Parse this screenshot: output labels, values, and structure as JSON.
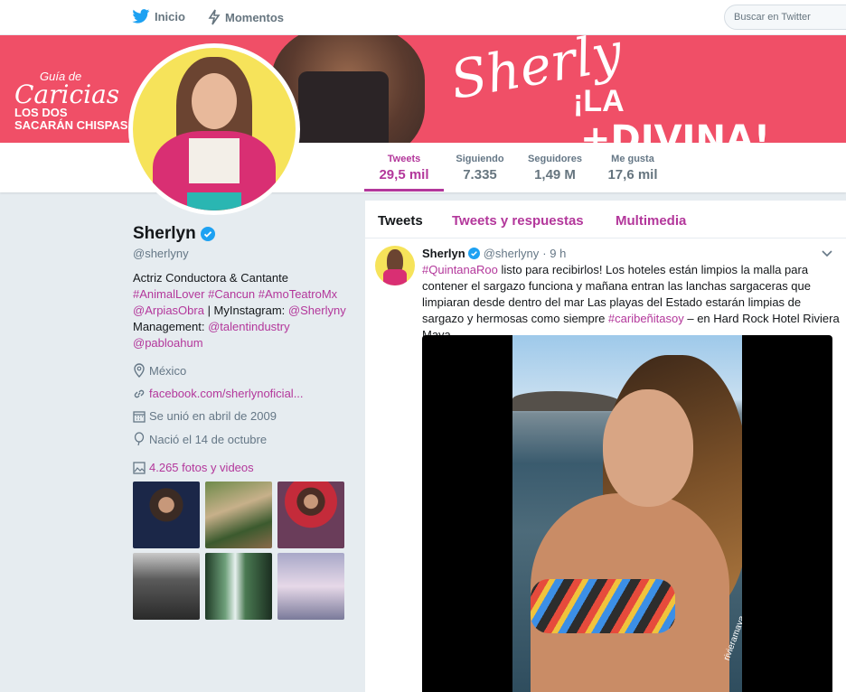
{
  "nav": {
    "home_label": "Inicio",
    "moments_label": "Momentos",
    "search_placeholder": "Buscar en Twitter"
  },
  "banner": {
    "guia_small": "Guía de",
    "guia_big": "Caricias",
    "guia_line1": "LOS DOS",
    "guia_line2": "SACARÁN CHISPAS",
    "script": "Sherly",
    "la": "¡LA",
    "divina": "+DIVINA!"
  },
  "stats": [
    {
      "label": "Tweets",
      "value": "29,5 mil"
    },
    {
      "label": "Siguiendo",
      "value": "7.335"
    },
    {
      "label": "Seguidores",
      "value": "1,49 M"
    },
    {
      "label": "Me gusta",
      "value": "17,6 mil"
    }
  ],
  "profile": {
    "name": "Sherlyn",
    "handle": "@sherlyny",
    "bio_line1": "Actriz Conductora & Cantante",
    "bio_tags": "#AnimalLover #Cancun #AmoTeatroMx",
    "bio_arpias": "@ArpiasObra",
    "bio_myinsta": " | MyInstagram: ",
    "bio_insta_handle": "@Sherlyny",
    "bio_management": "Management: ",
    "bio_talent": "@talentindustry",
    "bio_pablo": "@pabloahum",
    "location": "México",
    "website": "facebook.com/sherlynoficial...",
    "joined": "Se unió en abril de 2009",
    "birthday": "Nació el 14 de octubre",
    "photos_link": "4.265 fotos y videos"
  },
  "colors": {
    "accent": "#b3379b",
    "banner": "#f04f67",
    "verified": "#1da1f2",
    "nav_icon": "#1da1f2"
  },
  "timeline": {
    "tabs": [
      "Tweets",
      "Tweets y respuestas",
      "Multimedia"
    ],
    "tweet": {
      "name": "Sherlyn",
      "handle": "@sherlyny",
      "time": "· 9 h",
      "hashtag1": "#QuintanaRoo",
      "text1": " listo para recibirlos! Los hoteles están limpios la malla para contener el sargazo funciona  y mañana entran las lanchas sargaceras que limpiaran desde dentro del mar Las playas del Estado estarán limpias de sargazo y hermosas como siempre ",
      "hashtag2": "#caribeñitasoy",
      "text2": " – en Hard Rock Hotel Riviera Maya",
      "video_tag": "rivieramaya"
    }
  }
}
